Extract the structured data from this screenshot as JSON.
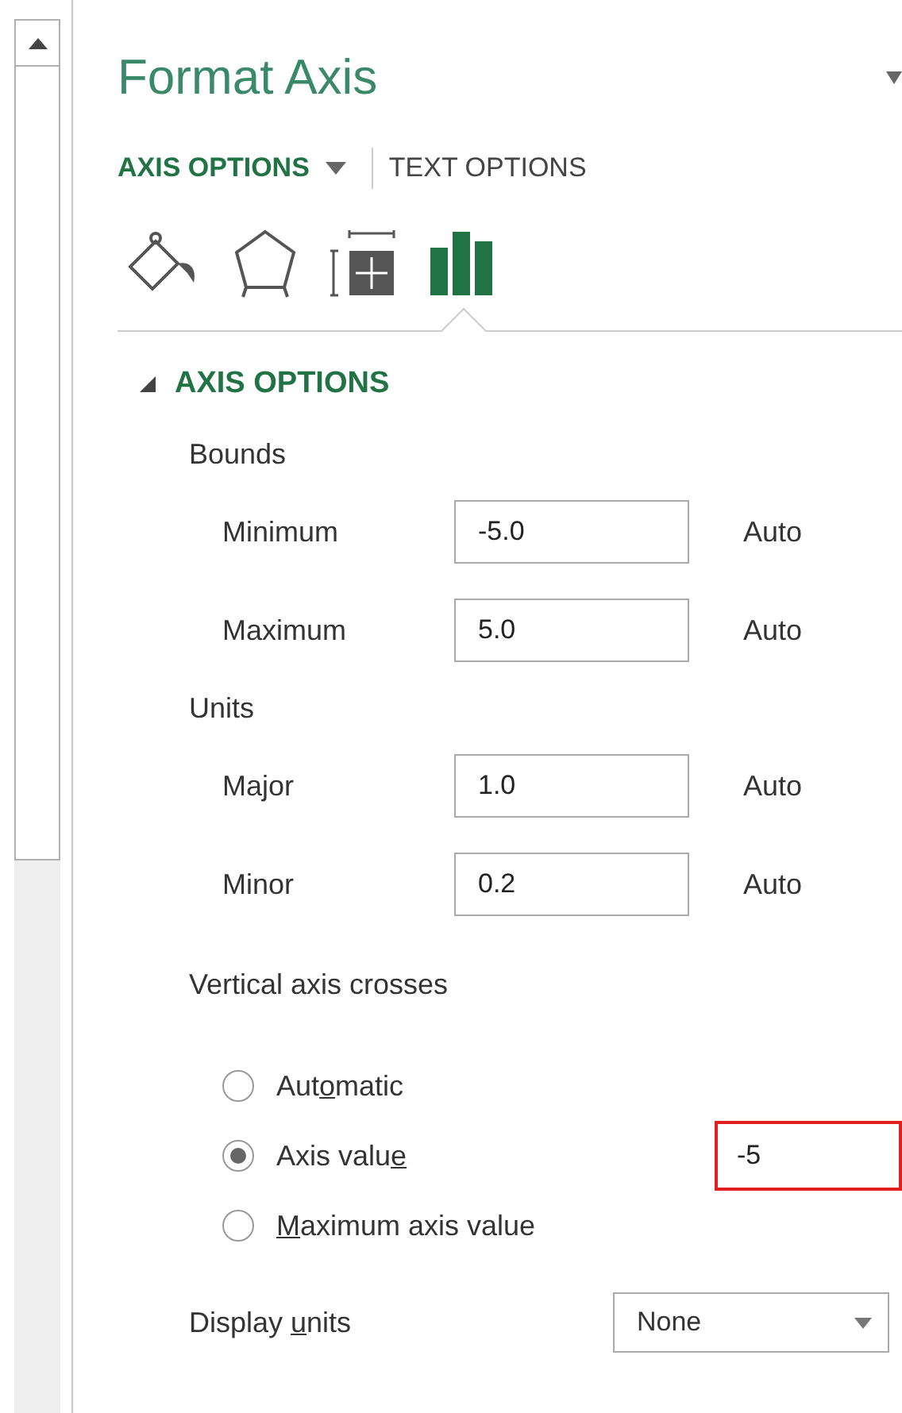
{
  "pane": {
    "title": "Format Axis"
  },
  "tabs": [
    {
      "label": "AXIS OPTIONS",
      "selected": true,
      "has_menu": true
    },
    {
      "label": "TEXT OPTIONS",
      "selected": false,
      "has_menu": false
    }
  ],
  "icon_tabs": [
    {
      "kind": "fill",
      "selected": false
    },
    {
      "kind": "effects",
      "selected": false
    },
    {
      "kind": "size",
      "selected": false
    },
    {
      "kind": "axis",
      "selected": true
    }
  ],
  "section": {
    "title": "AXIS OPTIONS",
    "expanded": true
  },
  "groups": [
    {
      "label": "Bounds",
      "rows": [
        {
          "label": "Minimum",
          "value": "-5.0",
          "action": "Auto"
        },
        {
          "label": "Maximum",
          "value": "5.0",
          "action": "Auto"
        }
      ]
    },
    {
      "label": "Units",
      "rows": [
        {
          "label": "Major",
          "value": "1.0",
          "action": "Auto"
        },
        {
          "label": "Minor",
          "value": "0.2",
          "action": "Auto"
        }
      ]
    }
  ],
  "crosses": {
    "label": "Vertical axis crosses",
    "options": [
      {
        "before": "Aut",
        "key": "o",
        "after": "matic",
        "selected": false
      },
      {
        "before": "Axis valu",
        "key": "e",
        "selected": true
      },
      {
        "key": "M",
        "after": "aximum axis value",
        "selected": false
      }
    ],
    "value": "-5",
    "highlighted": true
  },
  "display_units": {
    "before": "Display ",
    "key": "u",
    "after": "nits",
    "value": "None"
  }
}
